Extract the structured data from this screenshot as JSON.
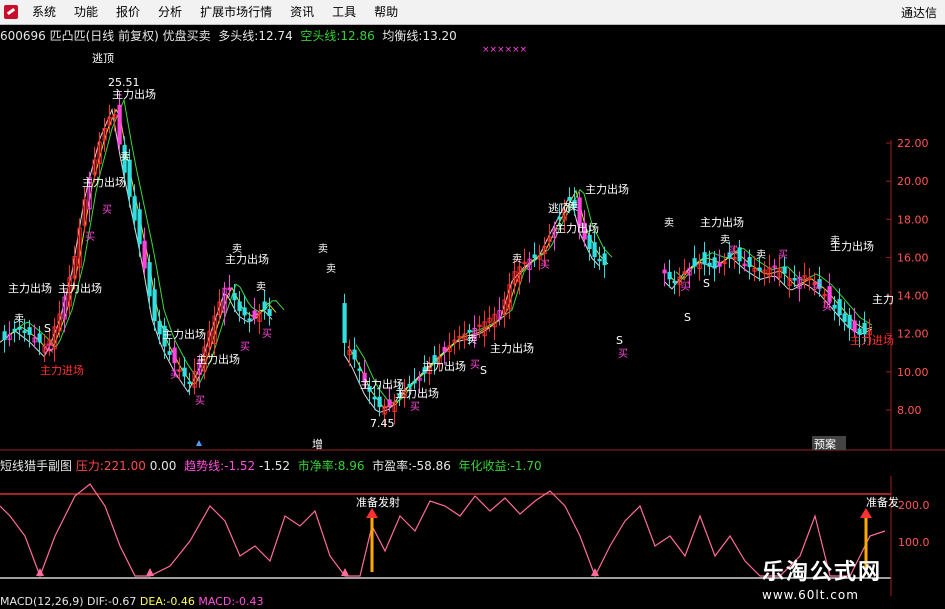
{
  "menu": {
    "items": [
      "系统",
      "功能",
      "报价",
      "分析",
      "扩展市场行情",
      "资讯",
      "工具",
      "帮助"
    ],
    "right": "通达信"
  },
  "header": {
    "stock": "600696 匹凸匹(日线 前复权)",
    "indicator": "优盘买卖",
    "bull_label": "多头线:",
    "bull_value": "12.74",
    "bear_label": "空头线:",
    "bear_value": "12.86",
    "balance_label": "均衡线:",
    "balance_value": "13.20"
  },
  "main_chart": {
    "annotations": {
      "escape_top": "逃顶",
      "high_price": "25.51",
      "low_price": "7.45",
      "main_out": "主力出场",
      "main_in": "主力进场",
      "sell": "卖",
      "buy": "买",
      "s": "S",
      "add": "增",
      "mark": "预案"
    },
    "y_axis": {
      "ticks": [
        "22.00",
        "20.00",
        "18.00",
        "16.00",
        "14.00",
        "12.00",
        "10.00",
        "8.00"
      ]
    }
  },
  "sub_chart": {
    "name": "短线猎手副图",
    "pressure_label": "压力:",
    "pressure_value": "221.00",
    "v2": "0.00",
    "trend_label": "趋势线:",
    "trend_value": "-1.52",
    "v3": "-1.52",
    "pb_label": "市净率:",
    "pb_value": "8.96",
    "pe_label": "市盈率:",
    "pe_value": "-58.86",
    "annual_label": "年化收益:",
    "annual_value": "-1.70",
    "signal": "准备发射",
    "signal_right": "准备发",
    "y_axis": {
      "ticks": [
        "200.0",
        "100.0"
      ]
    }
  },
  "macd_bar": {
    "name": "MACD(12,26,9)",
    "dif_label": "DIF:",
    "dif_value": "-0.67",
    "dea_label": "DEA:",
    "dea_value": "-0.46",
    "macd_label": "MACD:",
    "macd_value": "-0.43"
  },
  "watermark": {
    "name": "乐淘公式网",
    "url": "www.60lt.com"
  },
  "colors": {
    "up": "#ff3030",
    "down": "#30e0e0",
    "magenta": "#ff44dd",
    "yellow": "#ffff44",
    "white": "#ffffff"
  }
}
